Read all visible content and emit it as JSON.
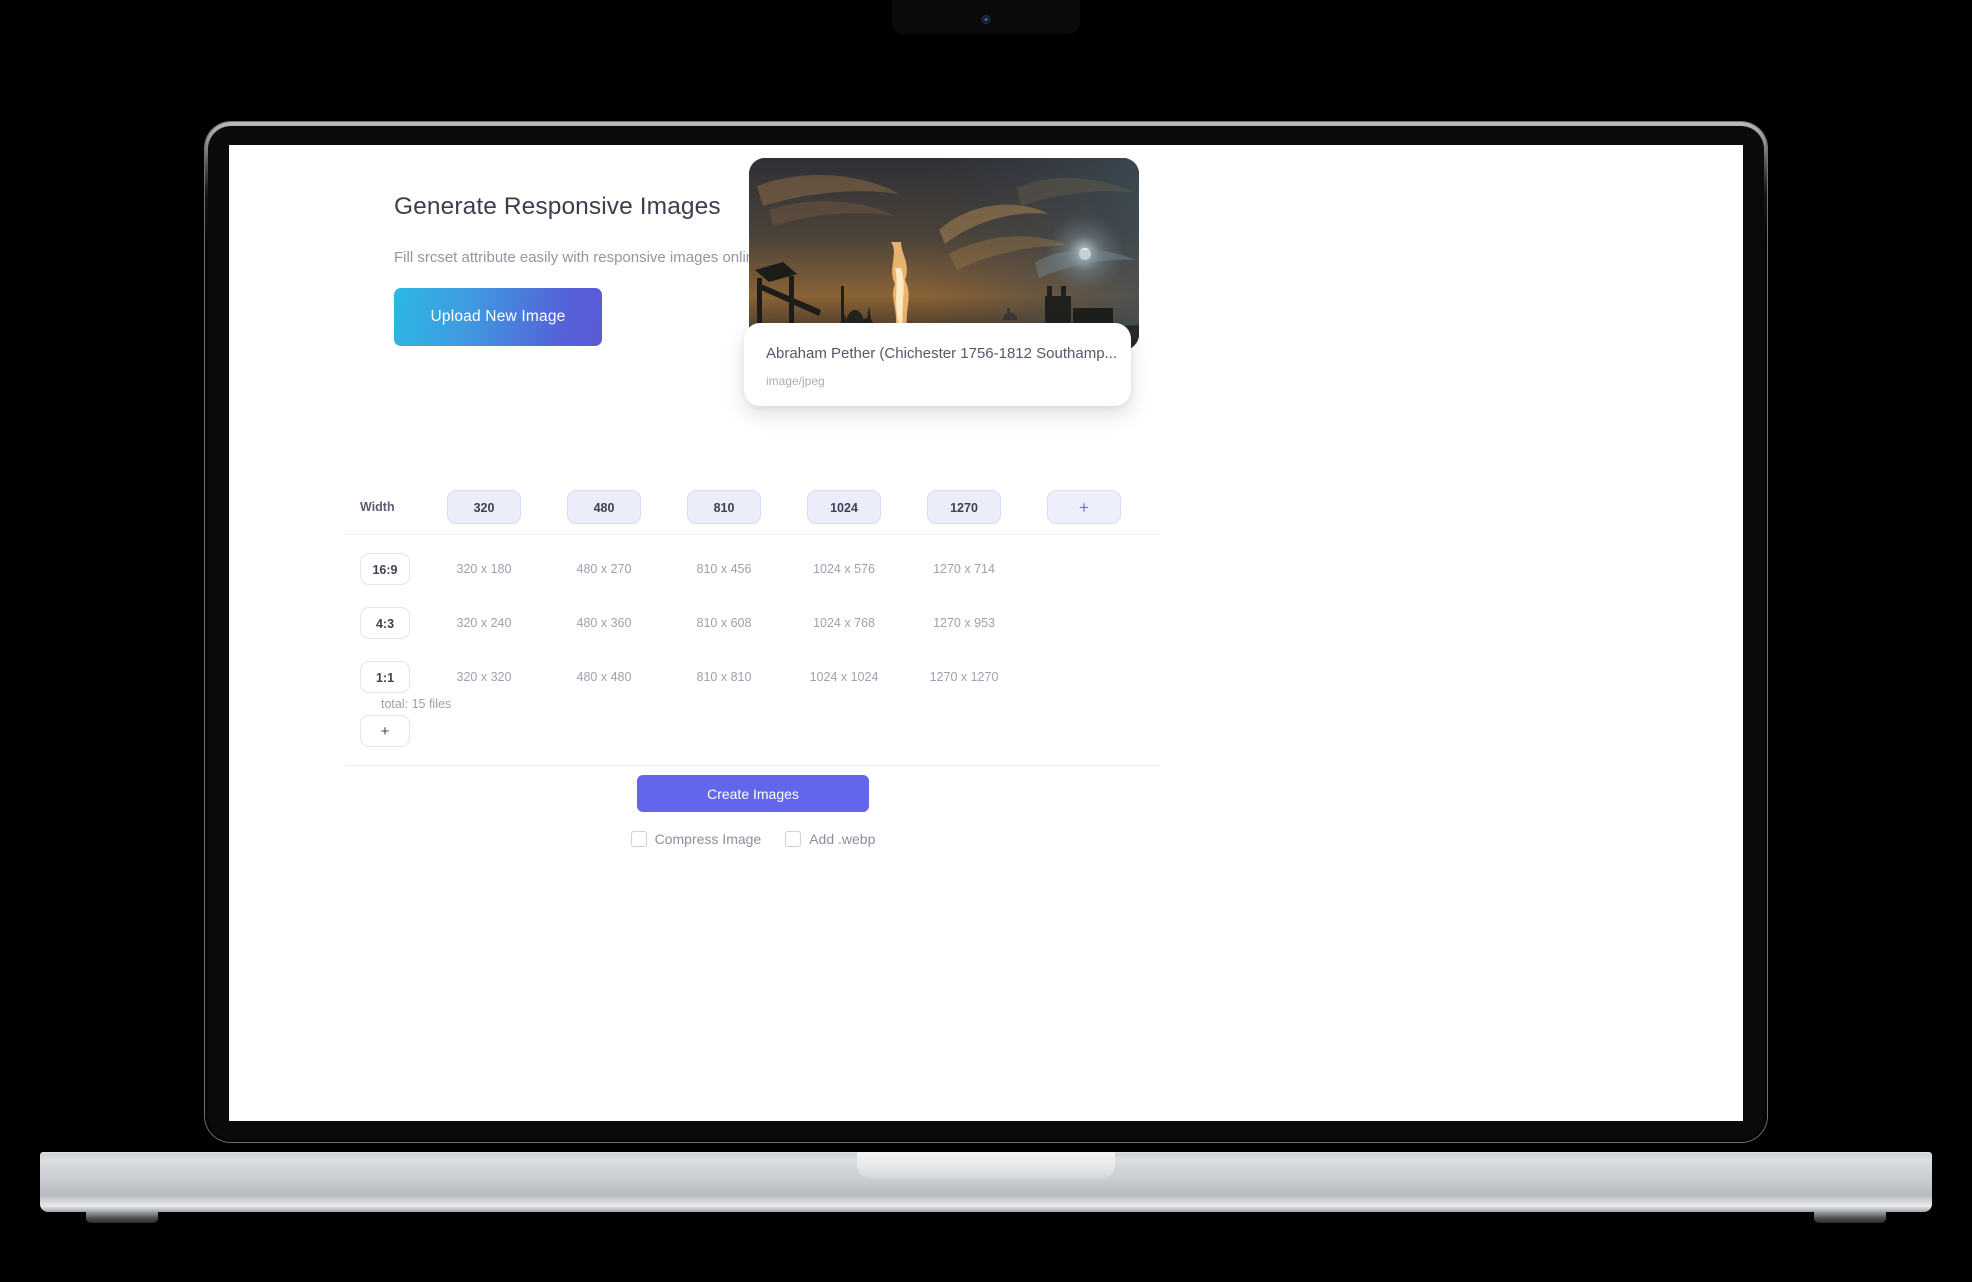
{
  "device": {
    "type": "laptop-mockup",
    "camera_icon": "camera-dot-icon"
  },
  "page": {
    "title": "Generate Responsive Images",
    "subtitle": "Fill srcset attribute easily with responsive images online generator.",
    "upload_button": "Upload New Image"
  },
  "file_card": {
    "title": "Abraham Pether (Chichester 1756-1812 Southamp...",
    "mime_type": "image/jpeg",
    "thumbnail_alt": "night landscape painting with moon and fire glow"
  },
  "table": {
    "width_header_label": "Width",
    "widths": [
      "320",
      "480",
      "810",
      "1024",
      "1270"
    ],
    "add_width_label": "+",
    "add_ratio_label": "+",
    "rows": [
      {
        "ratio": "16:9",
        "sizes": [
          "320 x 180",
          "480 x 270",
          "810 x 456",
          "1024 x 576",
          "1270 x 714"
        ]
      },
      {
        "ratio": "4:3",
        "sizes": [
          "320 x 240",
          "480 x 360",
          "810 x 608",
          "1024 x 768",
          "1270 x 953"
        ]
      },
      {
        "ratio": "1:1",
        "sizes": [
          "320 x 320",
          "480 x 480",
          "810 x 810",
          "1024 x 1024",
          "1270 x 1270"
        ]
      }
    ],
    "total": "total: 15 files"
  },
  "footer": {
    "create_button": "Create Images",
    "checkboxes": [
      {
        "label": "Compress Image",
        "checked": false
      },
      {
        "label": "Add .webp",
        "checked": false
      }
    ]
  },
  "colors": {
    "accent": "#6366ea",
    "upload_gradient_start": "#2cb7e3",
    "upload_gradient_end": "#5b5bd6",
    "chip_bg": "#ebedfb",
    "text_muted": "#9da1b0"
  }
}
